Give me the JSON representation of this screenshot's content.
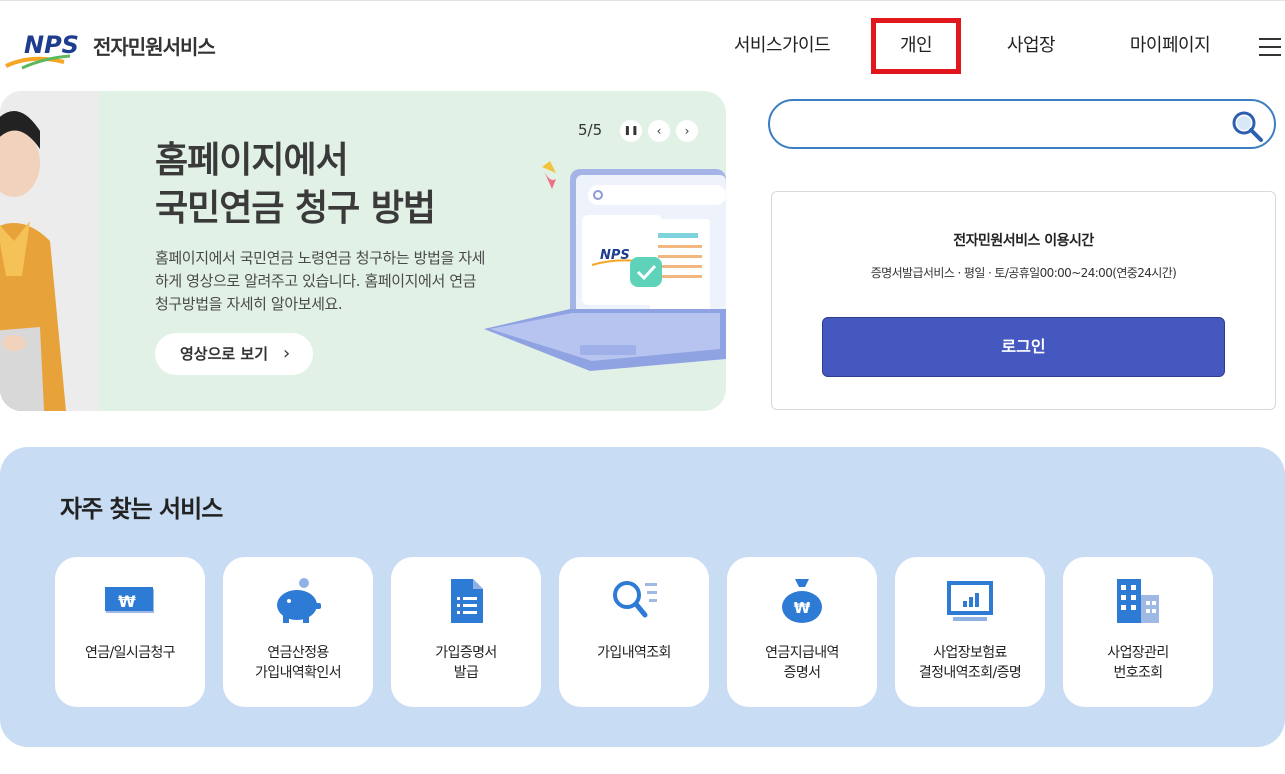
{
  "header": {
    "logo_mark": "NPS",
    "logo_text": "전자민원서비스",
    "nav": [
      {
        "label": "서비스가이드"
      },
      {
        "label": "개인"
      },
      {
        "label": "사업장"
      },
      {
        "label": "마이페이지"
      }
    ]
  },
  "banner": {
    "title_line1": "홈페이지에서",
    "title_line2": "국민연금 청구 방법",
    "description": "홈페이지에서 국민연금 노령연금 청구하는 방법을 자세하게 영상으로 알려주고 있습니다. 홈페이지에서 연금 청구방법을 자세히 알아보세요.",
    "button_label": "영상으로 보기",
    "pager": "5/5",
    "laptop_logo": "NPS"
  },
  "search": {
    "value": "",
    "placeholder": ""
  },
  "info": {
    "title": "전자민원서비스 이용시간",
    "text": "증명서발급서비스 · 평일 · 토/공휴일00:00~24:00(연중24시간)",
    "login_label": "로그인"
  },
  "frequent": {
    "title": "자주 찾는 서비스",
    "items": [
      {
        "line1": "연금/일시금청구",
        "line2": "",
        "icon": "won-bill-icon"
      },
      {
        "line1": "연금산정용",
        "line2": "가입내역확인서",
        "icon": "piggy-bank-icon"
      },
      {
        "line1": "가입증명서",
        "line2": "발급",
        "icon": "document-icon"
      },
      {
        "line1": "가입내역조회",
        "line2": "",
        "icon": "magnifier-list-icon"
      },
      {
        "line1": "연금지급내역",
        "line2": "증명서",
        "icon": "money-bag-icon"
      },
      {
        "line1": "사업장보험료",
        "line2": "결정내역조회/증명",
        "icon": "monitor-chart-icon"
      },
      {
        "line1": "사업장관리",
        "line2": "번호조회",
        "icon": "building-icon"
      }
    ]
  },
  "colors": {
    "accent_blue": "#4558c0",
    "highlight_red": "#e0181e",
    "services_bg": "#c8ddf4",
    "banner_bg": "#e2f1e6"
  }
}
